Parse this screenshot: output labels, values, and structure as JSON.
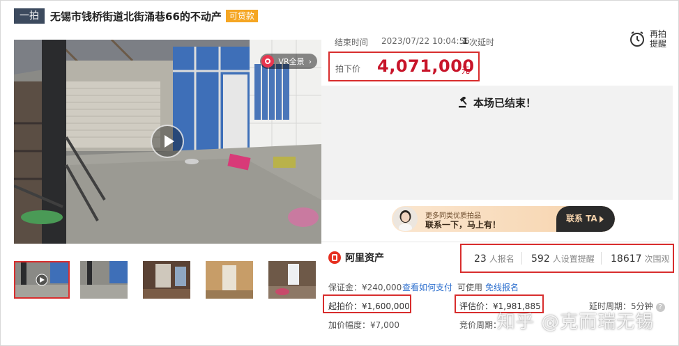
{
  "header": {
    "tag": "一拍",
    "title": "无锡市钱桥街道北街涌巷66的不动产",
    "loan_badge": "可贷款"
  },
  "media": {
    "vr_label": "VR全景",
    "thumbnail_count": 5
  },
  "auction": {
    "end_label": "结束时间",
    "end_time": "2023/07/22 10:04:56",
    "delay_count": "1",
    "delay_text": "次延时",
    "remind_label": "再拍提醒",
    "deal_price_label": "拍下价",
    "deal_price": "4,071,000",
    "currency_unit": "元",
    "ended_text": "本场已结束！"
  },
  "promo": {
    "line1": "更多同类优质拍品",
    "line2": "联系一下，马上有！",
    "button": "联系 TA"
  },
  "platform": {
    "name": "阿里资产"
  },
  "stats": [
    {
      "value": "23",
      "unit": "人报名"
    },
    {
      "value": "592",
      "unit": "人设置提醒"
    },
    {
      "value": "18617",
      "unit": "次围观"
    }
  ],
  "details": {
    "deposit": "保证金：¥240,000",
    "how_to_pay": "查看如何支付",
    "usable": "可使用",
    "free_signup": "免线报名",
    "start_price": "起拍价：¥1,600,000",
    "appraisal": "评估价：¥1,981,885",
    "delay_period": "延时周期：5分钟",
    "increment": "加价幅度：¥7,000",
    "bid_period": "竞价周期："
  },
  "watermark": "知乎 @克而瑞无锡",
  "colors": {
    "accent_red": "#c8152a",
    "highlight_box": "#d82d2d",
    "link_blue": "#2d6fce",
    "title_tag_bg": "#3c4a5e",
    "loan_badge_bg": "#f5a623"
  }
}
